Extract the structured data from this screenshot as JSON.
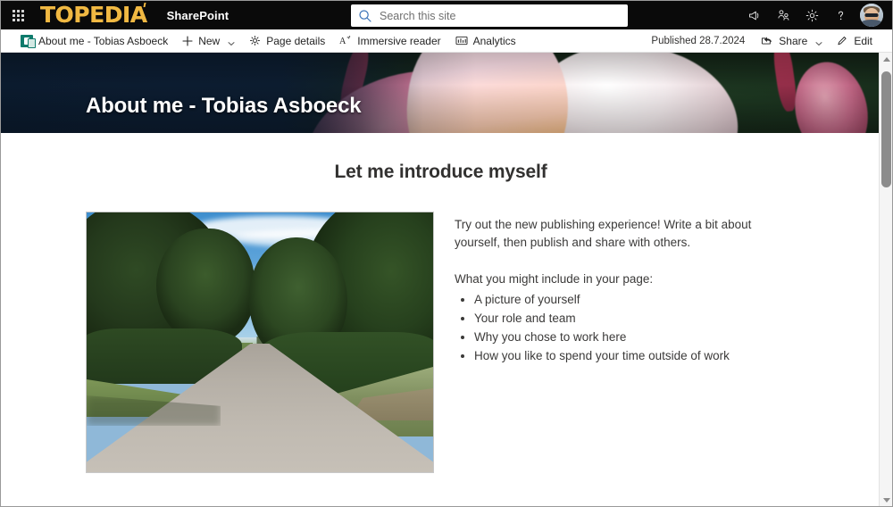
{
  "suite": {
    "waffle_label": "App launcher",
    "logo_text": "TOPEDIA",
    "app_name": "SharePoint",
    "icons": {
      "waffle": "waffle-grid-icon",
      "megaphone": "megaphone-icon",
      "meeting": "meet-now-icon",
      "settings": "gear-icon",
      "help": "question-mark-icon",
      "avatar": "user-avatar"
    }
  },
  "search": {
    "placeholder": "Search this site",
    "value": "",
    "icon": "search-icon"
  },
  "command_bar": {
    "page_link": "About me - Tobias Asboeck",
    "new_label": "New",
    "page_details_label": "Page details",
    "immersive_reader_label": "Immersive reader",
    "analytics_label": "Analytics",
    "published_label": "Published 28.7.2024",
    "share_label": "Share",
    "edit_label": "Edit"
  },
  "hero": {
    "title": "About me - Tobias Asboeck",
    "image_alt": "Close-up of pink and white plumeria flowers"
  },
  "main": {
    "section_title": "Let me introduce myself",
    "image_alt": "Country road lined with trees under a blue sky",
    "paragraphs": [
      "Try out the new publishing experience! Write a bit about yourself, then publish and share with others.",
      "What you might include in your page:"
    ],
    "bullets": [
      "A picture of yourself",
      "Your role and team",
      "Why you chose to work here",
      "How you like to spend your time outside of work"
    ]
  },
  "colors": {
    "suite_bar": "#0a0a0a",
    "brand_gold": "#f0b842",
    "accent_teal": "#0f7b6c",
    "text_primary": "#323130",
    "text_body": "#3b3a39"
  },
  "scrollbar": {
    "up_arrow": "scroll-up-arrow",
    "down_arrow": "scroll-down-arrow",
    "thumb": "scroll-thumb"
  }
}
